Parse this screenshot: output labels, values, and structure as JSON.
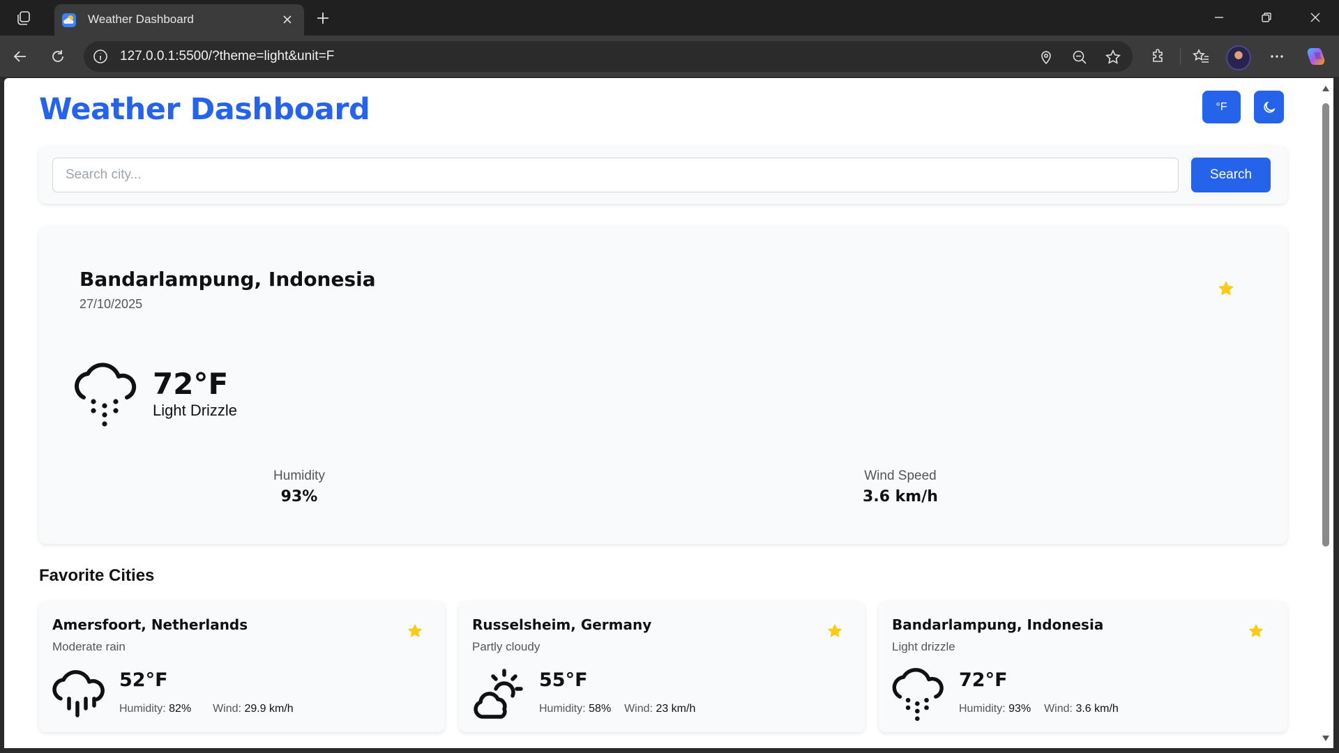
{
  "browser": {
    "tab_title": "Weather Dashboard",
    "url": "127.0.0.1:5500/?theme=light&unit=F"
  },
  "header": {
    "title": "Weather Dashboard",
    "unit_toggle_label": "°F",
    "theme_toggle_icon": "moon-icon"
  },
  "search": {
    "placeholder": "Search city...",
    "value": "",
    "button_label": "Search"
  },
  "current": {
    "city": "Bandarlampung, Indonesia",
    "date": "27/10/2025",
    "temperature": "72°F",
    "condition": "Light Drizzle",
    "icon": "drizzle-icon",
    "humidity_label": "Humidity",
    "humidity": "93%",
    "wind_label": "Wind Speed",
    "wind": "3.6 km/h",
    "favorited": true
  },
  "favorites": {
    "heading": "Favorite Cities",
    "humidity_label": "Humidity:",
    "wind_label": "Wind:",
    "items": [
      {
        "city": "Amersfoort, Netherlands",
        "condition": "Moderate rain",
        "temperature": "52°F",
        "humidity": "82%",
        "wind": "29.9 km/h",
        "icon": "rain-icon"
      },
      {
        "city": "Russelsheim, Germany",
        "condition": "Partly cloudy",
        "temperature": "55°F",
        "humidity": "58%",
        "wind": "23 km/h",
        "icon": "partly-cloudy-icon"
      },
      {
        "city": "Bandarlampung, Indonesia",
        "condition": "Light drizzle",
        "temperature": "72°F",
        "humidity": "93%",
        "wind": "3.6 km/h",
        "icon": "drizzle-icon"
      }
    ]
  },
  "colors": {
    "accent": "#2563eb",
    "star": "#facc15",
    "card_bg": "#f9fafb"
  }
}
